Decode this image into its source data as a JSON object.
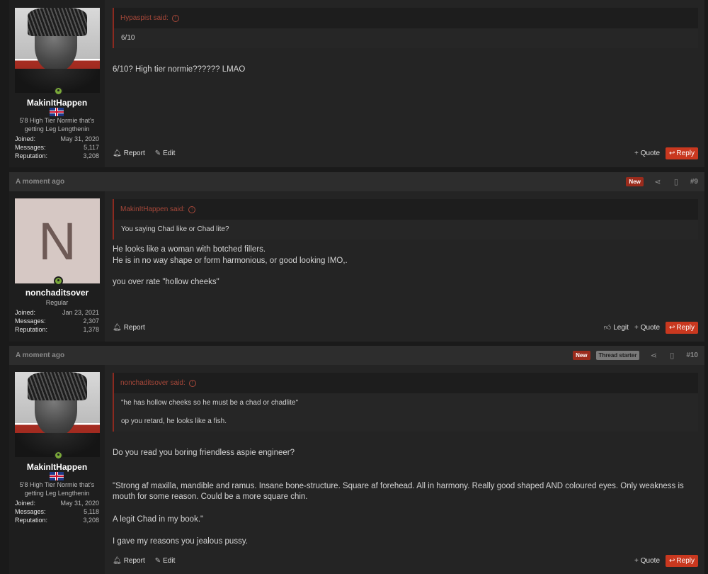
{
  "icons": {
    "quote_up": "↑",
    "share": "share-icon",
    "bookmark": "bookmark-icon",
    "report": "bell-icon",
    "edit": "pencil-icon",
    "legit": "thumbs-up-icon",
    "reply": "reply-icon"
  },
  "colors": {
    "accent": "#c9381f",
    "new_badge": "#9b2b1c",
    "online": "#7aa83a"
  },
  "posts": [
    {
      "user": {
        "name": "MakinItHappen",
        "title_line1": "5'8 High Tier Normie that's",
        "title_line2": "getting Leg Lengthenin",
        "joined_label": "Joined:",
        "joined": "May 31, 2020",
        "messages_label": "Messages:",
        "messages": "5,117",
        "reputation_label": "Reputation:",
        "reputation": "3,208"
      },
      "quote": {
        "author": "Hypaspist said:",
        "body": "6/10"
      },
      "message": [
        "6/10? High tier normie?????? LMAO"
      ],
      "actions": {
        "report": "Report",
        "edit": "Edit",
        "quote": "Quote",
        "reply": "Reply"
      }
    },
    {
      "header": {
        "time": "A moment ago",
        "badge_new": "New",
        "number": "#9"
      },
      "user": {
        "name": "nonchaditsover",
        "avatar_letter": "N",
        "title_line1": "Regular",
        "joined_label": "Joined:",
        "joined": "Jan 23, 2021",
        "messages_label": "Messages:",
        "messages": "2,307",
        "reputation_label": "Reputation:",
        "reputation": "1,378"
      },
      "quote": {
        "author": "MakinItHappen said:",
        "body": "You saying Chad like or Chad lite?"
      },
      "message": [
        "He looks like a woman with botched fillers.",
        "He is in no way shape or form harmonious, or good looking IMO,.",
        "you over rate \"hollow cheeks\""
      ],
      "actions": {
        "report": "Report",
        "legit": "Legit",
        "quote": "Quote",
        "reply": "Reply"
      }
    },
    {
      "header": {
        "time": "A moment ago",
        "badge_new": "New",
        "badge_starter": "Thread starter",
        "number": "#10"
      },
      "user": {
        "name": "MakinItHappen",
        "title_line1": "5'8 High Tier Normie that's",
        "title_line2": "getting Leg Lengthenin",
        "joined_label": "Joined:",
        "joined": "May 31, 2020",
        "messages_label": "Messages:",
        "messages": "5,118",
        "reputation_label": "Reputation:",
        "reputation": "3,208"
      },
      "quote": {
        "author": "nonchaditsover said:",
        "body1": "\"he has hollow cheeks so he must be a chad or chadlite\"",
        "body2": "op you retard, he looks like a fish."
      },
      "message": [
        "Do you read you boring friendless aspie engineer?",
        "\"Strong af maxilla, mandible and ramus. Insane bone-structure. Square af forehead. All in harmony. Really good shaped AND coloured eyes. Only weakness is mouth for some reason. Could be a more square chin.",
        "A legit Chad in my book.\"",
        "I gave my reasons you jealous pussy."
      ],
      "actions": {
        "report": "Report",
        "edit": "Edit",
        "quote": "Quote",
        "reply": "Reply"
      }
    }
  ]
}
